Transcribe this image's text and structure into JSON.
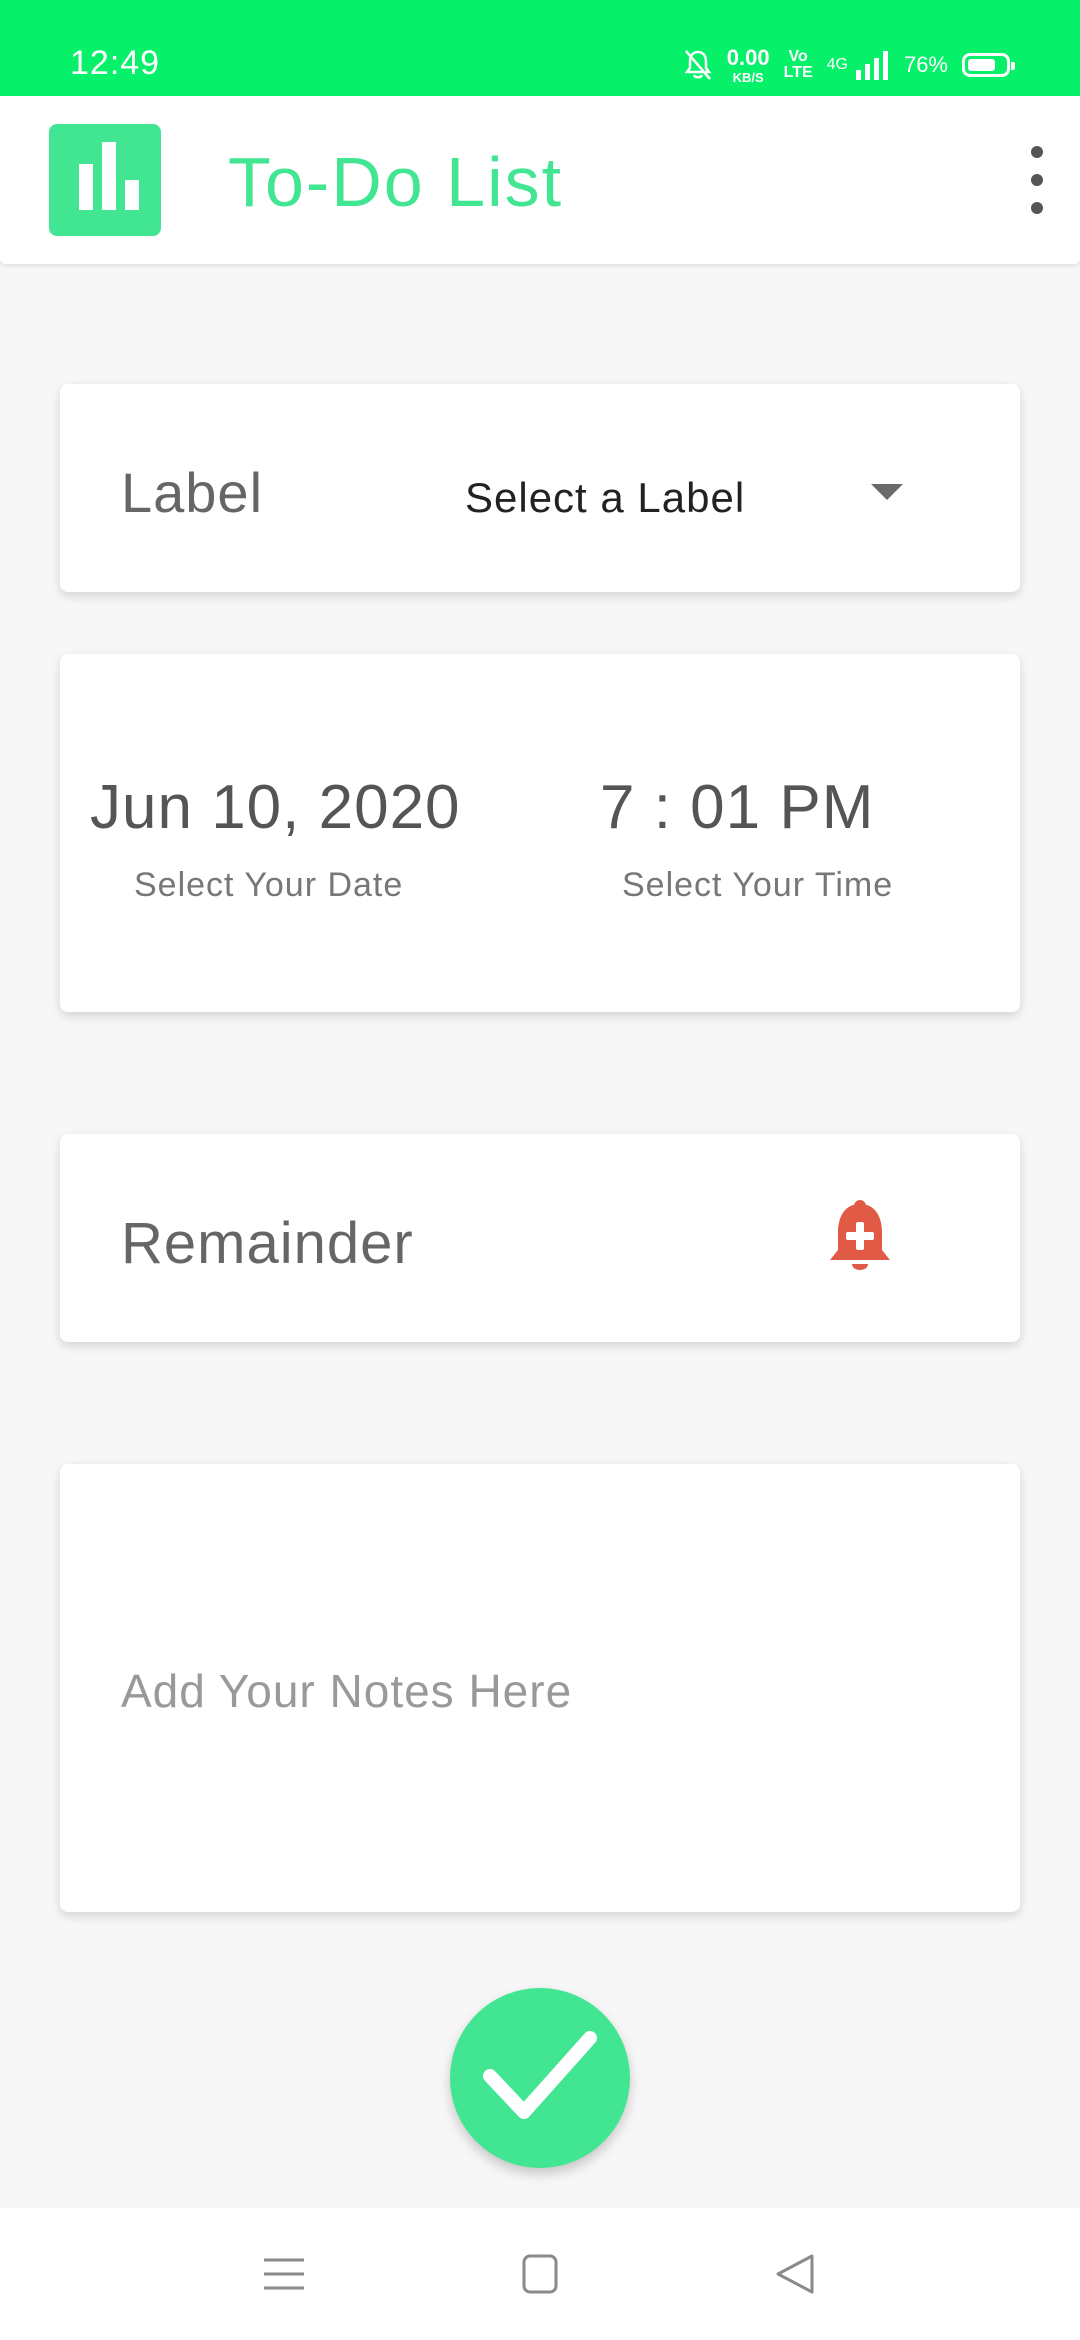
{
  "status_bar": {
    "time": "12:49",
    "net_speed_value": "0.00",
    "net_speed_unit": "KB/S",
    "volte_top": "Vo",
    "volte_bottom": "LTE",
    "network": "4G",
    "battery": "76%",
    "battery_level": 0.76
  },
  "app_bar": {
    "title": "To-Do List",
    "logo_icon": "bar-chart-icon",
    "menu_icon": "overflow-menu-icon"
  },
  "label_card": {
    "title": "Label",
    "select_value": "Select a Label"
  },
  "datetime_card": {
    "date": "Jun 10, 2020",
    "date_hint": "Select Your Date",
    "time": "7 : 01 PM",
    "time_hint": "Select Your Time"
  },
  "reminder_card": {
    "label": "Remainder",
    "icon": "bell-plus-icon"
  },
  "notes_card": {
    "placeholder": "Add Your Notes Here"
  },
  "fab": {
    "icon": "checkmark-icon"
  },
  "nav_bar": {
    "icons": [
      "menu-icon",
      "home-icon",
      "back-icon"
    ]
  },
  "colors": {
    "status_bar": "#07f06a",
    "accent": "#42e592",
    "bell": "#e05a46"
  }
}
